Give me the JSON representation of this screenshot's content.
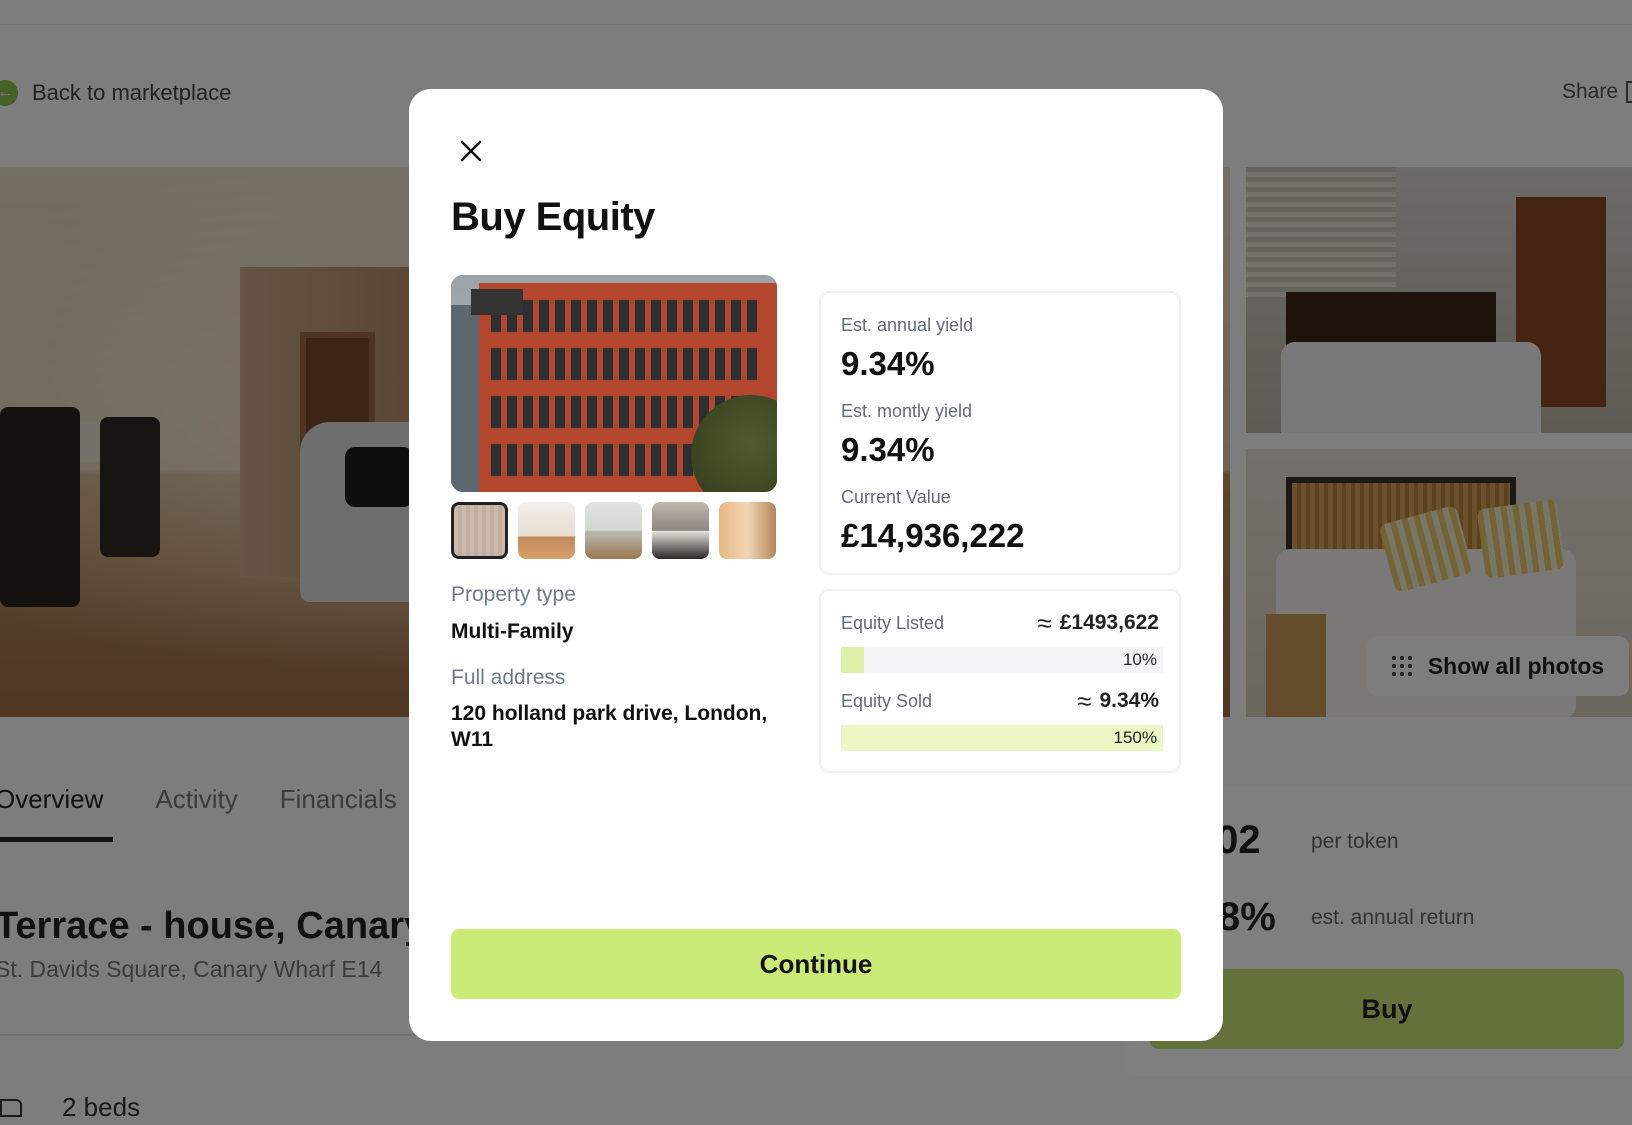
{
  "background": {
    "back_link": "Back to marketplace",
    "share": "Share",
    "show_all_photos": "Show all photos",
    "tabs": [
      "Overview",
      "Activity",
      "Financials"
    ],
    "property_title": "Terrace - house, Canary",
    "property_address": "St. Davids Square, Canary Wharf E14",
    "beds": "2 beds",
    "price_per_token_value": ".02",
    "price_per_token_label": "per token",
    "annual_return_value": "8%",
    "annual_return_label": "est. annual return",
    "buy_label": "Buy"
  },
  "modal": {
    "title": "Buy Equity",
    "close_icon": "close-icon",
    "thumbnail_count": 5,
    "selected_thumbnail": 1,
    "property_type_label": "Property type",
    "property_type_value": "Multi-Family",
    "full_address_label": "Full address",
    "full_address_value": "120 holland park drive, London, W11",
    "stats": {
      "annual_yield_label": "Est. annual yield",
      "annual_yield_value": "9.34%",
      "monthly_yield_label": "Est. montly yield",
      "monthly_yield_value": "9.34%",
      "current_value_label": "Current Value",
      "current_value_value": "£14,936,222"
    },
    "equity": {
      "approx_symbol": "≈",
      "listed_label": "Equity Listed",
      "listed_value": "£1493,622",
      "listed_pct": "10%",
      "listed_fill": 0.07,
      "sold_label": "Equity Sold",
      "sold_value": "9.34%",
      "sold_pct": "150%",
      "sold_fill": 1.0
    },
    "continue_label": "Continue"
  },
  "colors": {
    "accent": "#cbea76",
    "bar_listed": "#dff1a8",
    "bar_sold": "#ebf8c5"
  }
}
